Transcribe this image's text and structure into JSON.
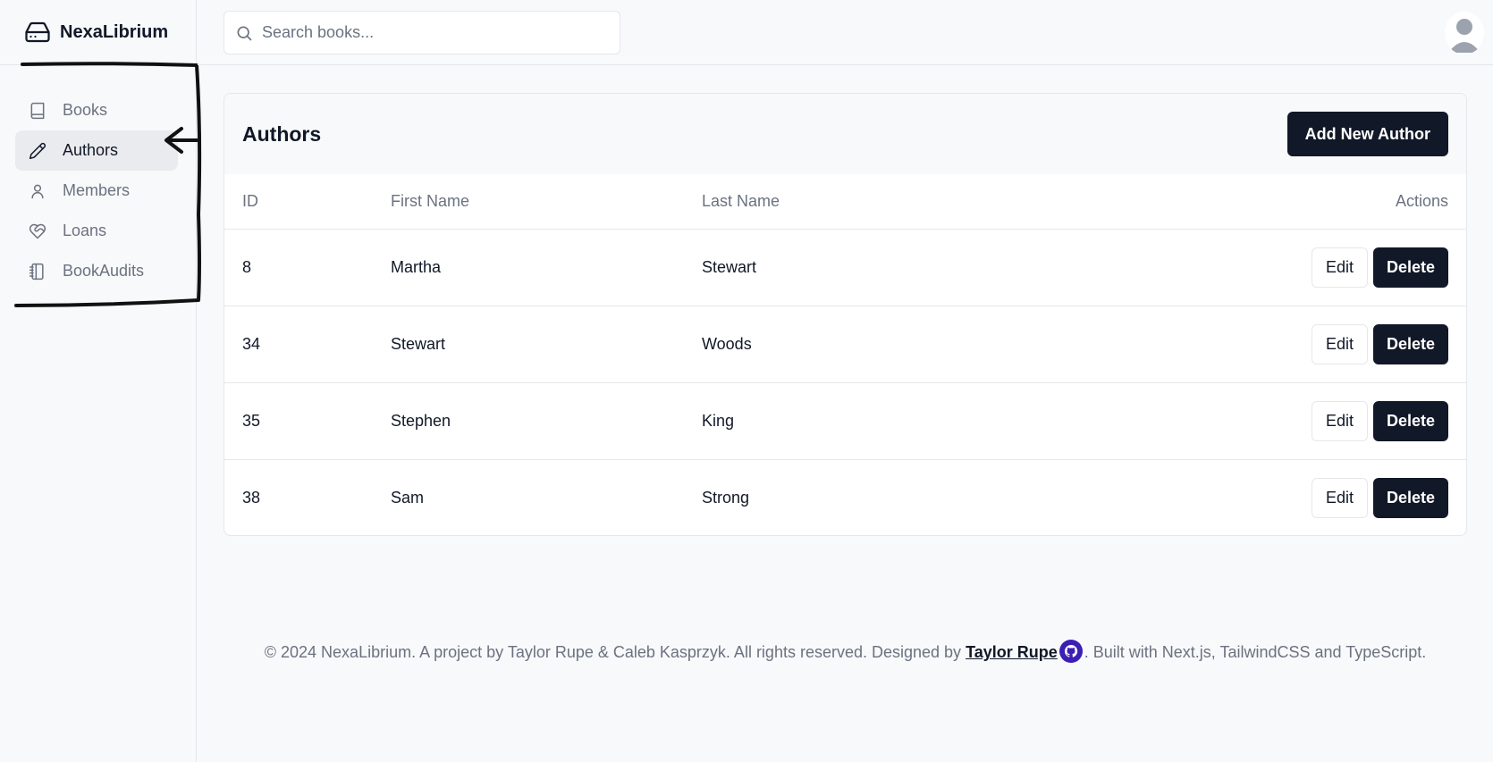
{
  "brand": {
    "name": "NexaLibrium"
  },
  "sidebar": {
    "items": [
      {
        "label": "Books",
        "icon": "book-icon"
      },
      {
        "label": "Authors",
        "icon": "pencil-icon",
        "active": true
      },
      {
        "label": "Members",
        "icon": "user-icon"
      },
      {
        "label": "Loans",
        "icon": "heart-handshake-icon"
      },
      {
        "label": "BookAudits",
        "icon": "notebook-icon"
      }
    ]
  },
  "header": {
    "search_placeholder": "Search books...",
    "search_value": ""
  },
  "main": {
    "title": "Authors",
    "add_button": "Add New Author",
    "columns": [
      "ID",
      "First Name",
      "Last Name",
      "Actions"
    ],
    "rows": [
      {
        "id": "8",
        "first": "Martha",
        "last": "Stewart"
      },
      {
        "id": "34",
        "first": "Stewart",
        "last": "Woods"
      },
      {
        "id": "35",
        "first": "Stephen",
        "last": "King"
      },
      {
        "id": "38",
        "first": "Sam",
        "last": "Strong"
      }
    ],
    "edit_label": "Edit",
    "delete_label": "Delete"
  },
  "footer": {
    "prefix": "© 2024 NexaLibrium. A project by Taylor Rupe & Caleb Kasprzyk. All rights reserved. Designed by ",
    "designer_link": "Taylor Rupe",
    "suffix": ". Built with Next.js, TailwindCSS and TypeScript."
  },
  "colors": {
    "primary": "#111827",
    "muted_text": "#6b7280",
    "background": "#f8f9fa",
    "border": "#e5e7eb",
    "github_icon": "#3b1fb5"
  }
}
